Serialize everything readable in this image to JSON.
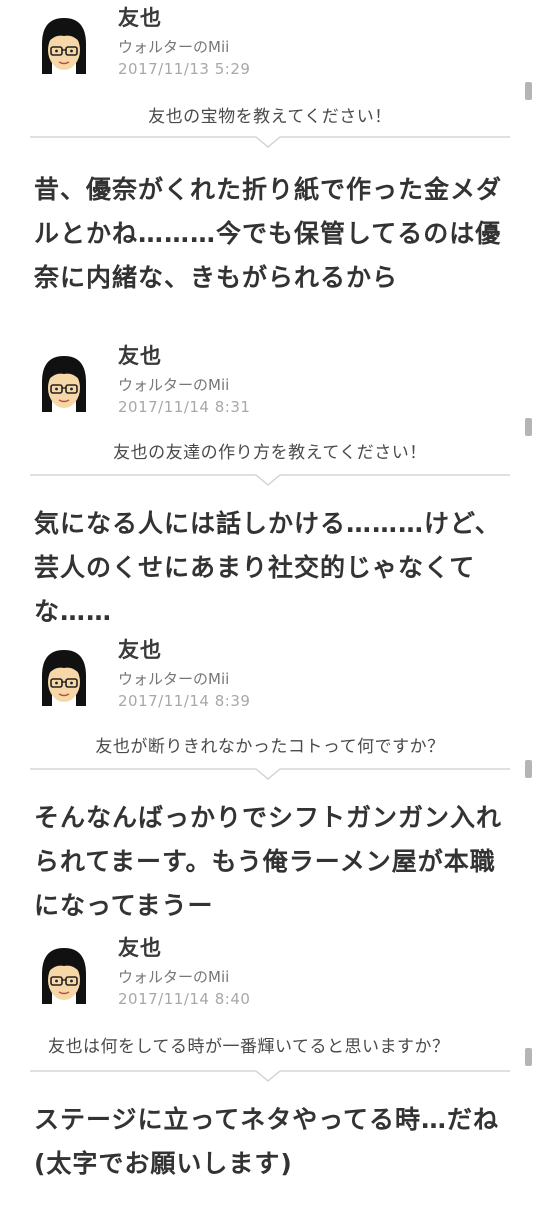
{
  "posts": [
    {
      "author": "友也",
      "owner": "ウォルターのMii",
      "date": "2017/11/13  5:29",
      "question": "友也の宝物を教えてください！",
      "answer": "昔、優奈がくれた折り紙で作った金メダルとかね………今でも保管してるのは優奈に内緒な、きもがられるから"
    },
    {
      "author": "友也",
      "owner": "ウォルターのMii",
      "date": "2017/11/14  8:31",
      "question": "友也の友達の作り方を教えてください！",
      "answer": "気になる人には話しかける………けど、芸人のくせにあまり社交的じゃなくてな……"
    },
    {
      "author": "友也",
      "owner": "ウォルターのMii",
      "date": "2017/11/14  8:39",
      "question": "友也が断りきれなかったコトって何ですか？",
      "answer": "そんなんばっかりでシフトガンガン入れられてまーす。もう俺ラーメン屋が本職になってまうー"
    },
    {
      "author": "友也",
      "owner": "ウォルターのMii",
      "date": "2017/11/14  8:40",
      "question": "友也は何をしてる時が一番輝いてると思いますか？",
      "answer": "ステージに立ってネタやってる時…だね(太字でお願いします)"
    }
  ],
  "colors": {
    "text_dark": "#333333",
    "text_muted": "#777777",
    "text_date": "#a8a8a8",
    "divider": "#d6d6d6",
    "scroll_marker": "#b5b5b5",
    "avatar_skin": "#f6d7a8",
    "avatar_hair": "#111111"
  },
  "icons": {
    "avatar": "mii-avatar-icon"
  }
}
